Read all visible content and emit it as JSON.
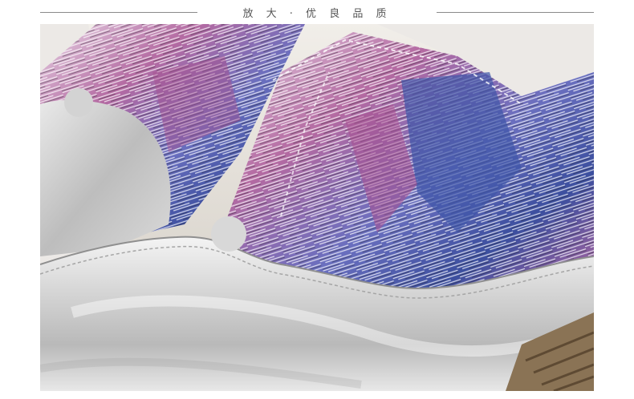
{
  "header": {
    "title": "放 大 · 优 良 品 质"
  },
  "photo": {
    "subject": "close-up-silver-slip-on-sneaker-with-floral-print",
    "colors": {
      "silver": "#d9d9d9",
      "silver_shadow": "#9a9a9a",
      "print_purple": "#a9508f",
      "print_blue": "#3f55a8",
      "print_black": "#1e1e22",
      "rope_sole": "#8a7355",
      "background": "#ece9e6"
    }
  }
}
